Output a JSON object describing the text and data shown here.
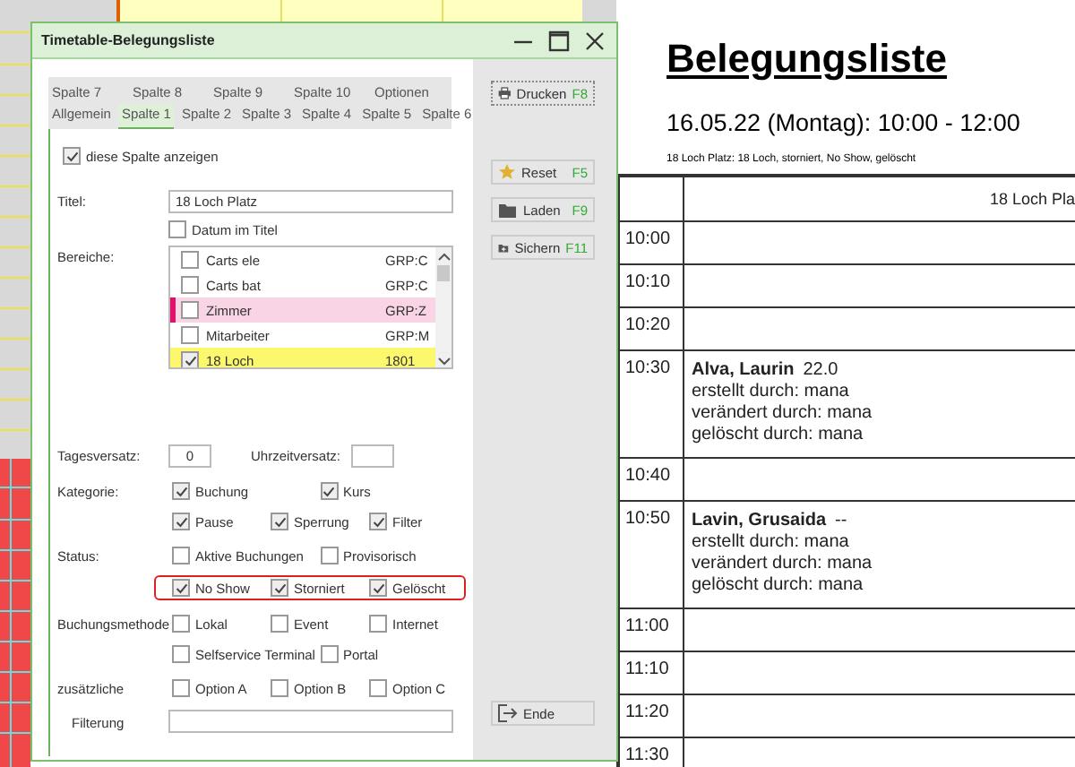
{
  "dialog": {
    "title": "Timetable-Belegungsliste",
    "tabs_row_1": [
      {
        "label": "Spalte 7",
        "selected": false
      },
      {
        "label": "Spalte 8",
        "selected": false
      },
      {
        "label": "Spalte 9",
        "selected": false
      },
      {
        "label": "Spalte 10",
        "selected": false
      },
      {
        "label": "Optionen",
        "selected": false
      }
    ],
    "tabs_row_2": [
      {
        "label": "Allgemein",
        "selected": false
      },
      {
        "label": "Spalte 1",
        "selected": true
      },
      {
        "label": "Spalte 2",
        "selected": false
      },
      {
        "label": "Spalte 3",
        "selected": false
      },
      {
        "label": "Spalte 4",
        "selected": false
      },
      {
        "label": "Spalte 5",
        "selected": false
      },
      {
        "label": "Spalte 6",
        "selected": false
      }
    ],
    "show_column": {
      "label": "diese Spalte anzeigen",
      "checked": true
    },
    "title_field": {
      "label": "Titel:",
      "value": "18 Loch Platz"
    },
    "date_in_title": {
      "label": "Datum im Titel",
      "checked": false
    },
    "areas": {
      "label": "Bereiche:",
      "items": [
        {
          "name": "Carts ele",
          "code": "GRP:C",
          "checked": false,
          "selected": false
        },
        {
          "name": "Carts bat",
          "code": "GRP:C",
          "checked": false,
          "selected": false
        },
        {
          "name": "Zimmer",
          "code": "GRP:Z",
          "checked": false,
          "selected": false,
          "color": "#e0106c"
        },
        {
          "name": "Mitarbeiter",
          "code": "GRP:M",
          "checked": false,
          "selected": false
        },
        {
          "name": "18 Loch",
          "code": "1801",
          "checked": true,
          "selected": true
        }
      ]
    },
    "day_offset": {
      "label": "Tagesversatz:",
      "value": "0"
    },
    "time_offset": {
      "label": "Uhrzeitversatz:"
    },
    "groups": [
      {
        "label": "Kategorie:",
        "rows": [
          {
            "highlighted": false,
            "items": [
              {
                "label": "Buchung",
                "checked": true
              },
              {
                "label": "Kurs",
                "checked": true
              }
            ]
          },
          {
            "highlighted": false,
            "items": [
              {
                "label": "Pause",
                "checked": true
              },
              {
                "label": "Sperrung",
                "checked": true
              },
              {
                "label": "Filter",
                "checked": true
              }
            ]
          }
        ]
      },
      {
        "label": "Status:",
        "rows": [
          {
            "highlighted": false,
            "items": [
              {
                "label": "Aktive Buchungen",
                "checked": false
              },
              {
                "label": "Provisorisch",
                "checked": false
              }
            ]
          },
          {
            "highlighted": true,
            "items": [
              {
                "label": "No Show",
                "checked": true
              },
              {
                "label": "Storniert",
                "checked": true
              },
              {
                "label": "Gelöscht",
                "checked": true
              }
            ]
          }
        ]
      },
      {
        "label": "Buchungsmethode",
        "rows": [
          {
            "highlighted": false,
            "items": [
              {
                "label": "Lokal",
                "checked": false
              },
              {
                "label": "Event",
                "checked": false
              },
              {
                "label": "Internet",
                "checked": false
              }
            ]
          },
          {
            "highlighted": false,
            "items": [
              {
                "label": "Selfservice Terminal",
                "checked": false
              },
              {
                "label": "Portal",
                "checked": false
              }
            ]
          }
        ]
      },
      {
        "label": "zusätzliche",
        "rows": [
          {
            "highlighted": false,
            "items": [
              {
                "label": "Option A",
                "checked": false
              },
              {
                "label": "Option B",
                "checked": false
              },
              {
                "label": "Option C",
                "checked": false
              }
            ]
          }
        ]
      }
    ],
    "filter": {
      "label": "Filterung"
    },
    "buttons": [
      {
        "kind": "print",
        "label": "Drucken",
        "key": "F8"
      },
      {
        "kind": "reset",
        "label": "Reset",
        "key": "F5"
      },
      {
        "kind": "load",
        "label": "Laden",
        "key": "F9"
      },
      {
        "kind": "save",
        "label": "Sichern",
        "key": "F11"
      },
      {
        "kind": "exit",
        "label": "Ende"
      }
    ]
  },
  "document": {
    "title": "Belegungsliste",
    "subtitle": "16.05.22 (Montag): 10:00 - 12:00",
    "filter_line": "18 Loch Platz: 18 Loch, storniert, No Show, gelöscht",
    "column_header": "18 Loch Pla",
    "rows": [
      {
        "time": "10:00",
        "entry": null
      },
      {
        "time": "10:10",
        "entry": null
      },
      {
        "time": "10:20",
        "entry": null
      },
      {
        "time": "10:30",
        "entry": {
          "name": "Alva, Laurin",
          "extra": "22.0",
          "lines": [
            "erstellt durch: mana",
            "verändert durch: mana",
            "gelöscht durch: mana"
          ]
        }
      },
      {
        "time": "10:40",
        "entry": null
      },
      {
        "time": "10:50",
        "entry": {
          "name": "Lavin, Grusaida",
          "extra": "--",
          "lines": [
            "erstellt durch: mana",
            "verändert durch: mana",
            "gelöscht durch: mana"
          ]
        }
      },
      {
        "time": "11:00",
        "entry": null
      },
      {
        "time": "11:10",
        "entry": null
      },
      {
        "time": "11:20",
        "entry": null
      },
      {
        "time": "11:30",
        "entry": null
      }
    ]
  }
}
